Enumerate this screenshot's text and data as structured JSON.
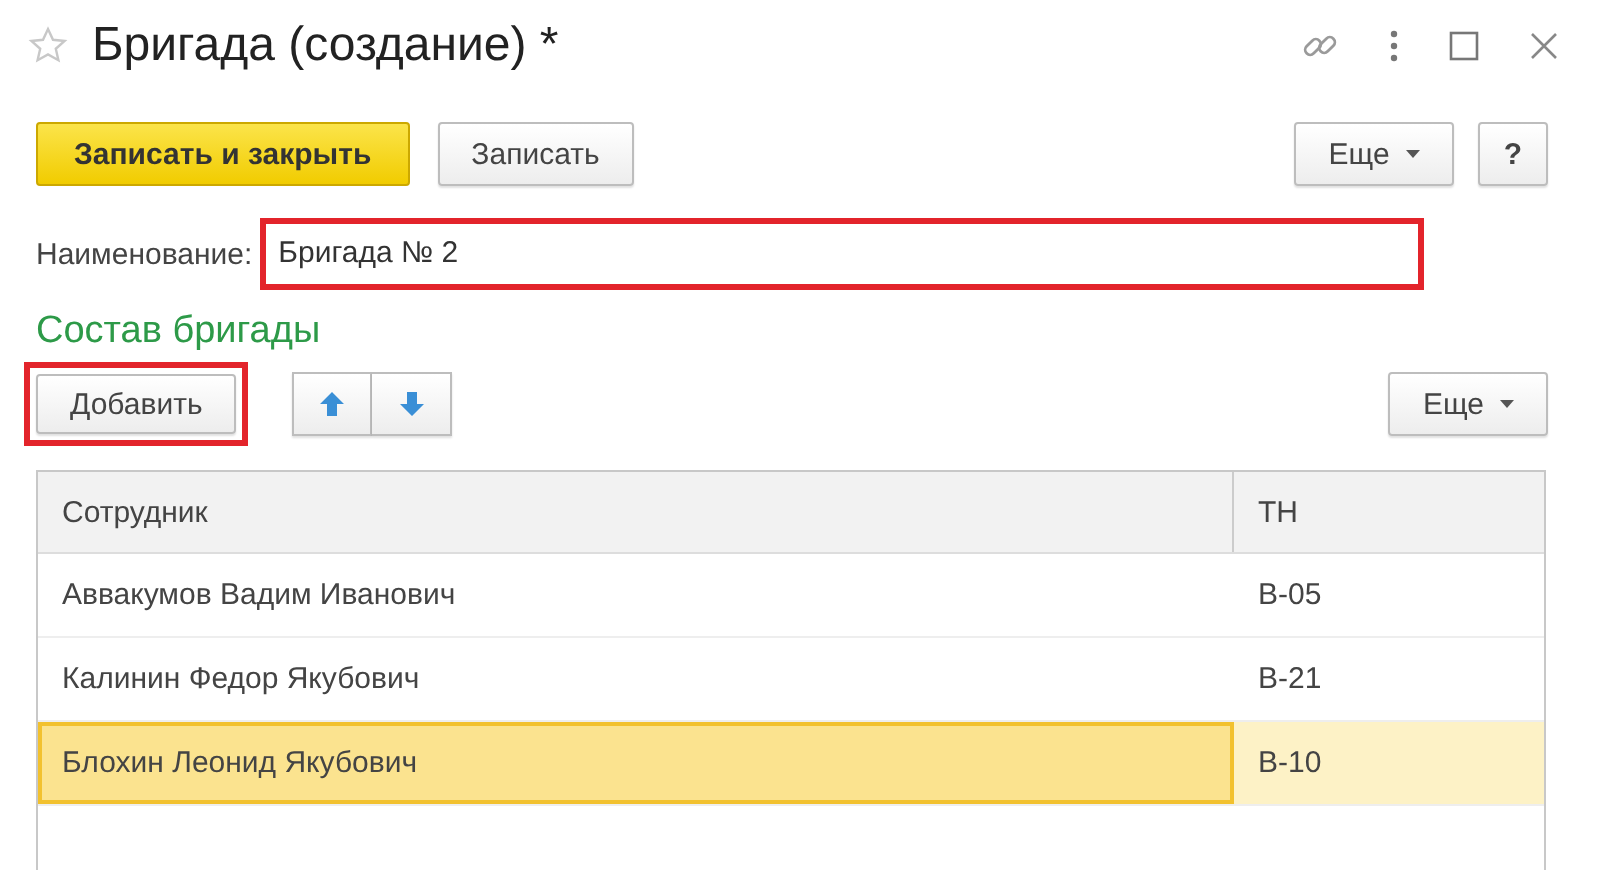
{
  "window": {
    "title": "Бригада (создание) *",
    "favorite": false
  },
  "toolbar": {
    "buttons": [
      {
        "label": "Записать и закрыть",
        "kind": "primary"
      },
      {
        "label": "Записать",
        "kind": "normal"
      }
    ],
    "more": "Еще",
    "help": "?"
  },
  "name_field": {
    "label": "Наименование:",
    "value": "Бригада № 2",
    "highlighted": true
  },
  "section": {
    "title": "Состав бригады"
  },
  "table_toolbar": {
    "add": {
      "label": "Добавить",
      "highlighted": true
    },
    "more": "Еще"
  },
  "table": {
    "columns": [
      "Сотрудник",
      "ТН"
    ],
    "rows": [
      {
        "cells": [
          "Аввакумов Вадим Иванович",
          "В-05"
        ],
        "selected": false
      },
      {
        "cells": [
          "Калинин Федор Якубович",
          "В-21"
        ],
        "selected": false
      },
      {
        "cells": [
          "Блохин Леонид Якубович",
          "В-10"
        ],
        "selected": true
      }
    ]
  }
}
